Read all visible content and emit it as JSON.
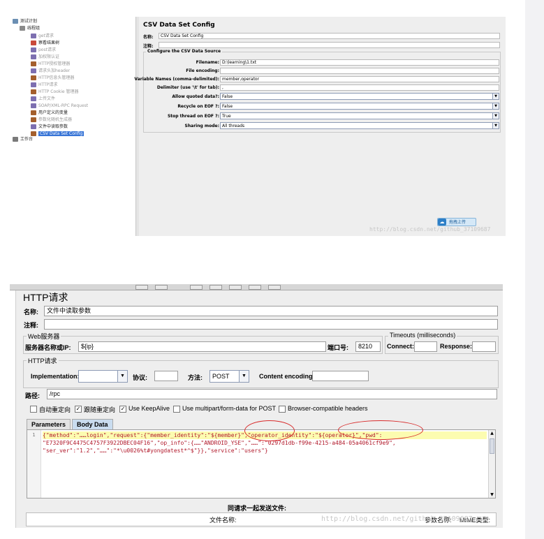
{
  "top_window": {
    "tree": [
      {
        "label": "测试计划",
        "icon": "test-plan-icon",
        "disabled": false,
        "selected": false
      },
      {
        "label": "线程组",
        "icon": "thread-group-icon",
        "disabled": false,
        "selected": false
      },
      {
        "label": "get请求",
        "icon": "pen-icon",
        "disabled": true,
        "selected": false
      },
      {
        "label": "察看结果树",
        "icon": "results-tree-icon",
        "disabled": false,
        "selected": false
      },
      {
        "label": "post请求",
        "icon": "pen-icon",
        "disabled": true,
        "selected": false
      },
      {
        "label": "加权限认证",
        "icon": "pen-icon",
        "disabled": true,
        "selected": false
      },
      {
        "label": "HTTP授权管理器",
        "icon": "config-icon",
        "disabled": true,
        "selected": false
      },
      {
        "label": "请求头加header",
        "icon": "pen-icon",
        "disabled": true,
        "selected": false
      },
      {
        "label": "HTTP信息头管理器",
        "icon": "config-icon",
        "disabled": true,
        "selected": false
      },
      {
        "label": "HTTP请求",
        "icon": "pen-icon",
        "disabled": true,
        "selected": false
      },
      {
        "label": "HTTP Cookie 管理器",
        "icon": "config-icon",
        "disabled": true,
        "selected": false
      },
      {
        "label": "上传文件",
        "icon": "pen-icon",
        "disabled": true,
        "selected": false
      },
      {
        "label": "SOAP/XML-RPC Request",
        "icon": "pen-icon",
        "disabled": true,
        "selected": false
      },
      {
        "label": "用户定义的变量",
        "icon": "config-icon",
        "disabled": false,
        "selected": false
      },
      {
        "label": "参数化随机生成器",
        "icon": "config-icon",
        "disabled": true,
        "selected": false
      },
      {
        "label": "文件中读取参数",
        "icon": "pen-icon",
        "disabled": false,
        "selected": false
      },
      {
        "label": "CSV Data Set Config",
        "icon": "config-icon",
        "disabled": false,
        "selected": true
      },
      {
        "label": "工作台",
        "icon": "workbench-icon",
        "disabled": false,
        "selected": false
      }
    ],
    "config": {
      "title": "CSV Data Set Config",
      "name_label": "名称:",
      "name_value": "CSV Data Set Config",
      "comment_label": "注释:",
      "group_caption": "Configure the CSV Data Source",
      "filename_label": "Filename:",
      "filename_value": "D:\\learning\\1.txt",
      "encoding_label": "File encoding:",
      "encoding_value": "",
      "varnames_label": "Variable Names (comma-delimited):",
      "varnames_value": "member,operator",
      "delimiter_label": "Delimiter (use '\\t' for tab):",
      "delimiter_value": ",",
      "quoted_label": "Allow quoted data?:",
      "quoted_value": "False",
      "recycle_label": "Recycle on EOF ?:",
      "recycle_value": "False",
      "stop_label": "Stop thread on EOF ?:",
      "stop_value": "True",
      "sharing_label": "Sharing mode:",
      "sharing_value": "All threads"
    },
    "upload_button": "拖拽上传",
    "watermark": "http://blog.csdn.net/github_37109687"
  },
  "bottom_window": {
    "title": "HTTP请求",
    "name_label": "名称:",
    "name_value": "文件中读取参数",
    "comment_label": "注释:",
    "web_server_caption": "Web服务器",
    "server_label": "服务器名称或IP:",
    "server_value": "${ip}",
    "port_label": "端口号:",
    "port_value": "8210",
    "timeouts_caption": "Timeouts (milliseconds)",
    "connect_label": "Connect:",
    "response_label": "Response:",
    "http_caption": "HTTP请求",
    "implementation_label": "Implementation:",
    "protocol_label": "协议:",
    "method_label": "方法:",
    "method_value": "POST",
    "content_encoding_label": "Content encoding:",
    "path_label": "路径:",
    "path_value": "/rpc",
    "checkboxes": [
      {
        "label": "自动重定向",
        "checked": false
      },
      {
        "label": "跟随重定向",
        "checked": true
      },
      {
        "label": "Use KeepAlive",
        "checked": true
      },
      {
        "label": "Use multipart/form-data for POST",
        "checked": false
      },
      {
        "label": "Browser-compatible headers",
        "checked": false
      }
    ],
    "tabs": [
      "Parameters",
      "Body Data"
    ],
    "active_tab": "Body Data",
    "line_number": "1",
    "body_lines": [
      "{\"method\":\"……login\",\"request\":{\"member_identity\":\"${member}\",\"operator_identity\":\"${operator}\",\"pwd\":",
      "\"E7320F9C4475C4757F3922DBEC04F16\",\"op_info\":{……\"ANDROID_YSE\",\"……\":\"0297d1db-f99e-4215-a484-05a4061cf9e9\",",
      "\"ser_ver\":\"1.2\",\"……\":\"*\\u0026%t#yongdatest*^$\"}},\"service\":\"users\"}"
    ],
    "files_caption": "同请求一起发送文件:",
    "file_col": "文件名称:",
    "param_col": "参数名称:",
    "mime_col": "MIME类型:",
    "watermark": "http://blog.csdn.net/github_37109687"
  }
}
